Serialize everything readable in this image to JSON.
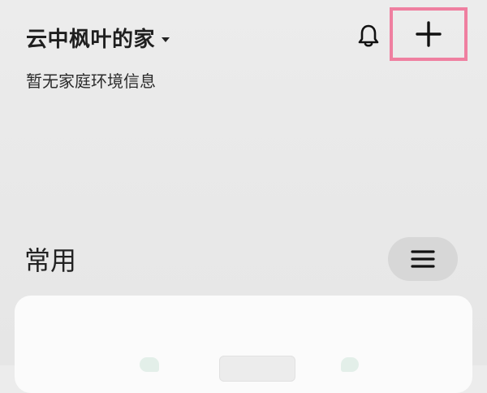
{
  "header": {
    "home_name": "云中枫叶的家",
    "subtitle": "暂无家庭环境信息"
  },
  "section": {
    "title": "常用"
  },
  "icons": {
    "dropdown": "chevron-down-icon",
    "notification": "bell-icon",
    "add": "plus-icon",
    "menu": "hamburger-icon"
  },
  "colors": {
    "highlight_border": "#ef7fa0",
    "background": "#e9e9e9",
    "card": "#fbfbfb",
    "menu_button": "#d7d7d7"
  }
}
